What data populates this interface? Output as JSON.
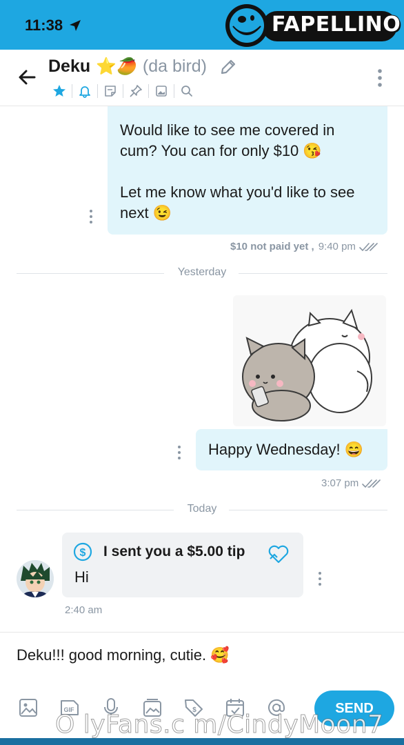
{
  "status_bar": {
    "time": "11:38"
  },
  "brand": {
    "logo_text": "FAPELLINO"
  },
  "header": {
    "name": "Deku",
    "name_emoji": "⭐🥭",
    "nickname": "(da bird)"
  },
  "messages": {
    "promo_text": "Would like to see me covered in\ncum? You can for only $10 😘\n\nLet me know what you'd like to see\nnext 😉",
    "promo_status": "$10 not paid yet ,",
    "promo_time": "9:40 pm",
    "divider_yesterday": "Yesterday",
    "wednesday_text": "Happy Wednesday! 😄",
    "wednesday_time": "3:07 pm",
    "divider_today": "Today",
    "tip_label": "I sent you a $5.00 tip",
    "tip_message": "Hi",
    "tip_time": "2:40 am"
  },
  "composer": {
    "draft_text": "Deku!!! good morning, cutie. 🥰",
    "send_label": "SEND"
  },
  "watermark": "O lyFans.c m/CindyMoon7",
  "colors": {
    "accent": "#1ea7e1",
    "bubble_out": "#e1f5fb",
    "bubble_in": "#f0f2f4",
    "muted": "#8a96a3"
  }
}
